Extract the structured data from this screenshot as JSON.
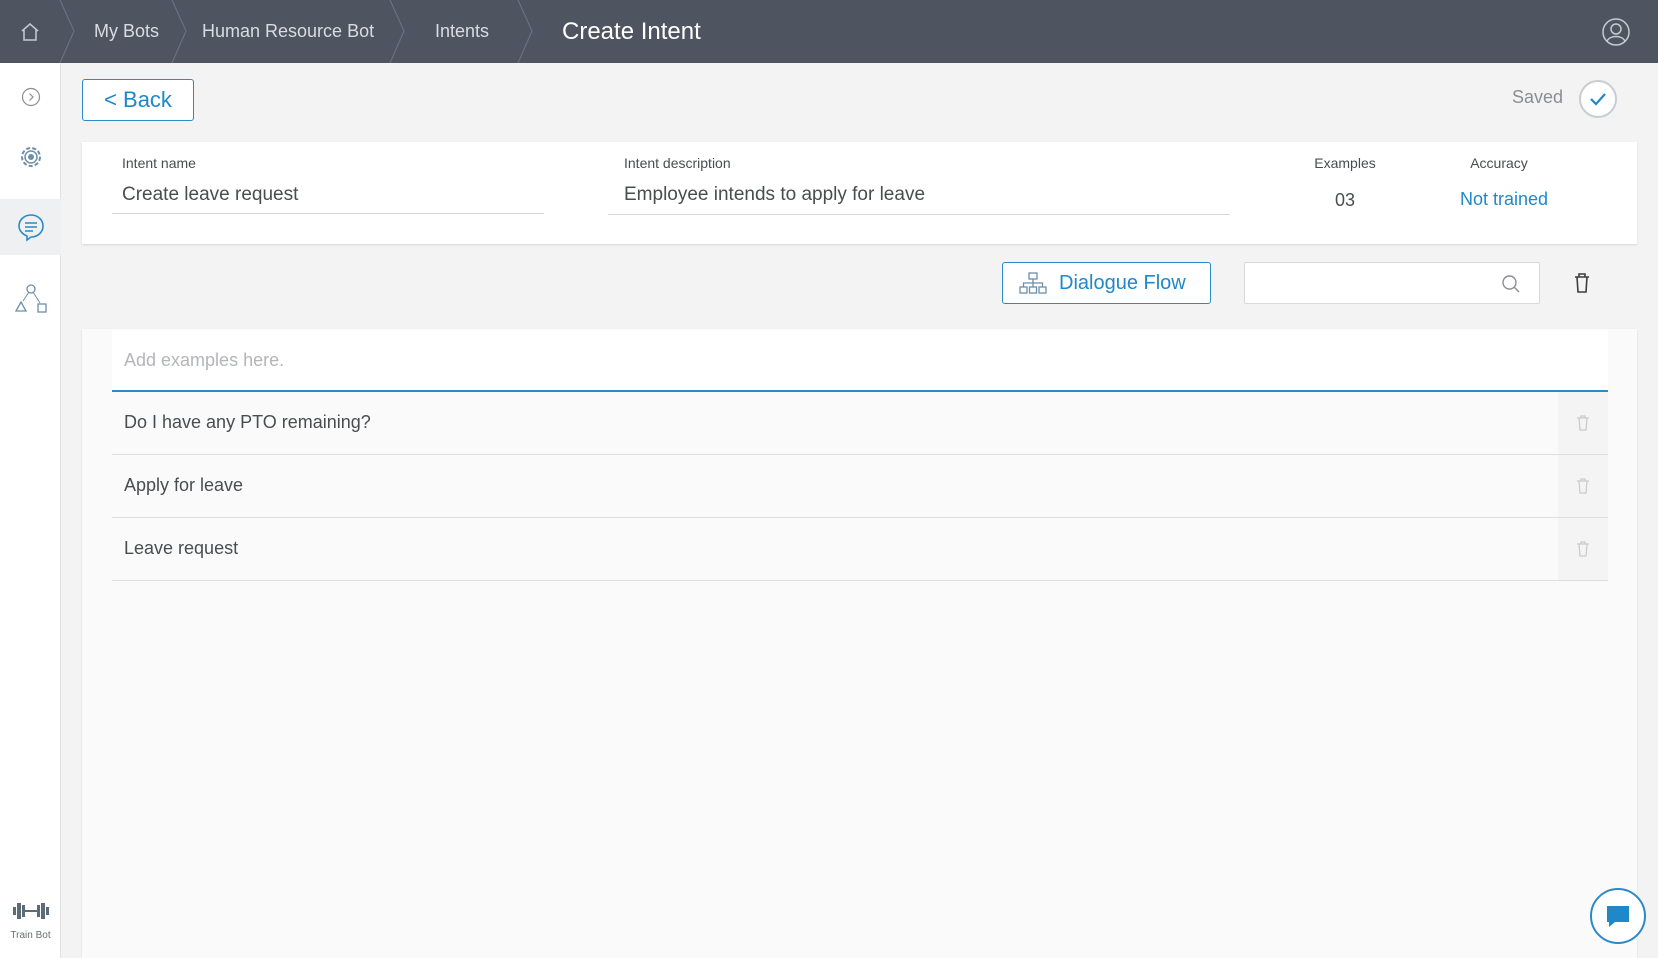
{
  "header": {
    "breadcrumbs": [
      {
        "label": "My Bots"
      },
      {
        "label": "Human Resource Bot"
      },
      {
        "label": "Intents"
      }
    ],
    "page_title": "Create Intent"
  },
  "sidebar": {
    "train_label": "Train Bot"
  },
  "toolbar": {
    "back_label": "< Back",
    "saved_label": "Saved"
  },
  "intent": {
    "name_label": "Intent name",
    "name_value": "Create leave request",
    "description_label": "Intent description",
    "description_value": "Employee intends to apply for leave",
    "examples_label": "Examples",
    "examples_count": "03",
    "accuracy_label": "Accuracy",
    "accuracy_value": "Not trained"
  },
  "actions": {
    "dialogue_flow_label": "Dialogue Flow",
    "search_value": ""
  },
  "examples": {
    "input_placeholder": "Add examples here.",
    "items": [
      {
        "text": "Do I have any PTO remaining?"
      },
      {
        "text": "Apply for leave"
      },
      {
        "text": "Leave request"
      }
    ]
  },
  "colors": {
    "header_bg": "#4f5461",
    "accent": "#1f88c9"
  }
}
